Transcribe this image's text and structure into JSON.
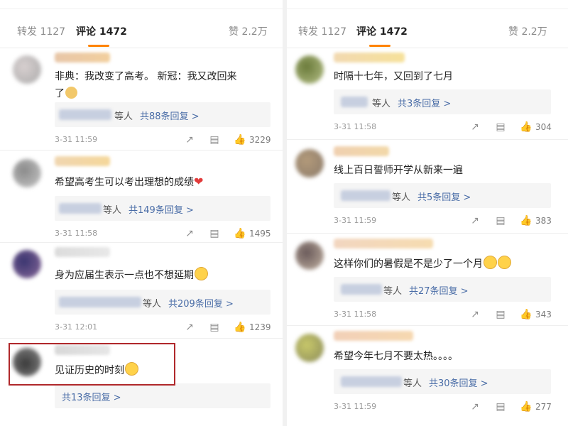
{
  "left": {
    "tabs": {
      "repost": "转发 1127",
      "comment": "评论 1472",
      "like": "赞 2.2万"
    },
    "comments": [
      {
        "text_line1": "非典：我改变了高考。 新冠：我又改回来",
        "text_line2": "了",
        "emoji": "doge",
        "reply_prefix": "等人",
        "reply_link": "共88条回复 >",
        "time": "3-31 11:59",
        "likes": "3229"
      },
      {
        "text": "希望高考生可以考出理想的成绩",
        "emoji": "heart",
        "reply_prefix": "等人",
        "reply_link": "共149条回复 >",
        "time": "3-31 11:58",
        "likes": "1495"
      },
      {
        "text": "身为应届生表示一点也不想延期",
        "emoji": "cry",
        "reply_prefix": "等人",
        "reply_link": "共209条回复 >",
        "time": "3-31 12:01",
        "likes": "1239"
      },
      {
        "text": "见证历史的时刻",
        "emoji": "laugh",
        "reply_link": "共13条回复 >"
      }
    ]
  },
  "right": {
    "tabs": {
      "repost": "转发 1127",
      "comment": "评论 1472",
      "like": "赞 2.2万"
    },
    "comments": [
      {
        "text": "时隔十七年，又回到了七月",
        "reply_prefix": "等人",
        "reply_link": "共3条回复 >",
        "time": "3-31 11:58",
        "likes": "304"
      },
      {
        "text": "线上百日誓师开学从新来一遍",
        "reply_prefix": "等人",
        "reply_link": "共5条回复 >",
        "time": "3-31 11:59",
        "likes": "383"
      },
      {
        "text": "这样你们的暑假是不是少了一个月",
        "emoji": "laugh",
        "reply_prefix": "等人",
        "reply_link": "共27条回复 >",
        "time": "3-31 11:58",
        "likes": "343"
      },
      {
        "text": "希望今年七月不要太热。。。。",
        "reply_prefix": "等人",
        "reply_link": "共30条回复 >",
        "time": "3-31 11:59",
        "likes": "277"
      }
    ]
  },
  "colors": {
    "accent": "#ff8200",
    "link": "#4a6da7",
    "highlight": "#b0282b"
  }
}
